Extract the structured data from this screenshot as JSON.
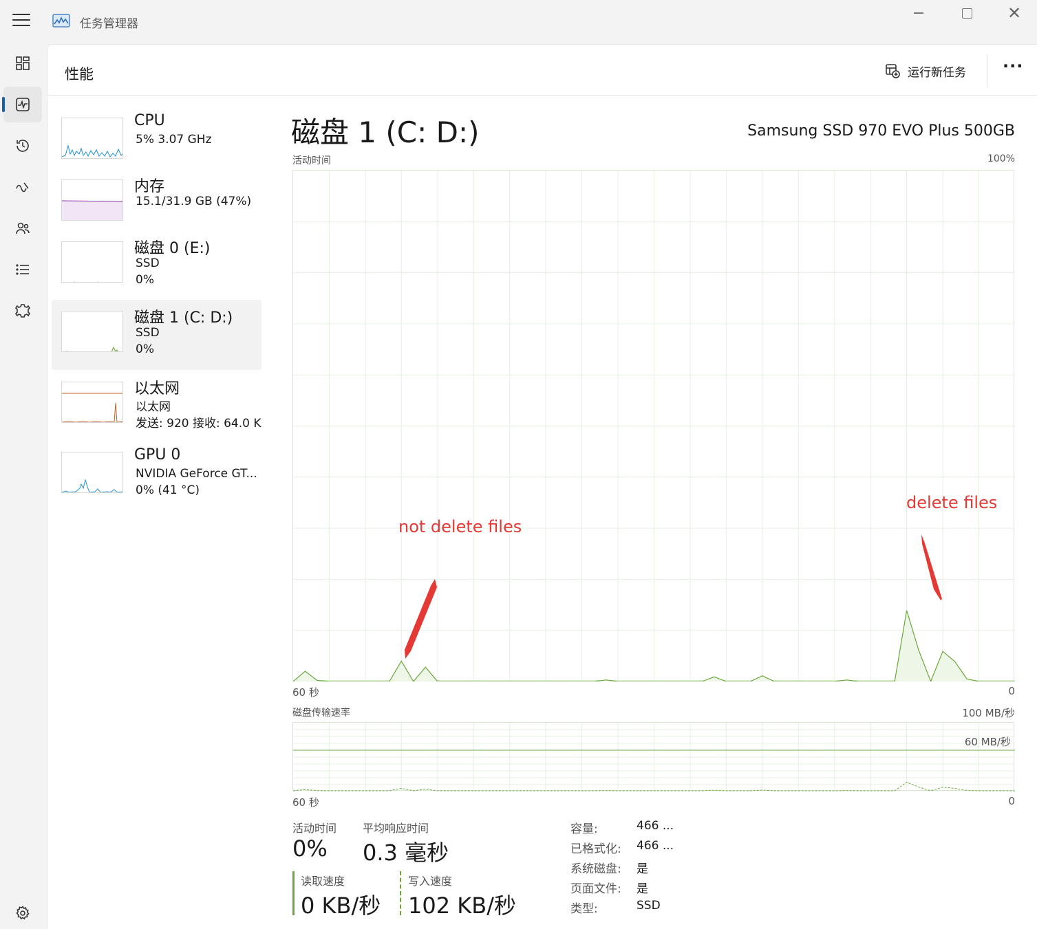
{
  "window": {
    "title": "任务管理器",
    "close_glyph": "✕"
  },
  "header": {
    "page_title": "性能",
    "run_new_task": "运行新任务",
    "more": "···"
  },
  "devices": [
    {
      "name": "CPU",
      "lines": [
        "5%  3.07 GHz"
      ]
    },
    {
      "name": "内存",
      "lines": [
        "15.1/31.9 GB (47%)"
      ]
    },
    {
      "name": "磁盘 0 (E:)",
      "lines": [
        "SSD",
        "0%"
      ]
    },
    {
      "name": "磁盘 1 (C: D:)",
      "lines": [
        "SSD",
        "0%"
      ]
    },
    {
      "name": "以太网",
      "lines": [
        "以太网",
        "发送: 920  接收: 64.0 K"
      ]
    },
    {
      "name": "GPU 0",
      "lines": [
        "NVIDIA GeForce GT...",
        "0%  (41 °C)"
      ]
    }
  ],
  "detail": {
    "title": "磁盘 1 (C: D:)",
    "model": "Samsung SSD 970 EVO Plus 500GB",
    "activity_label": "活动时间",
    "activity_max": "100%",
    "activity_time_left": "60 秒",
    "activity_time_right": "0",
    "transfer_label": "磁盘传输速率",
    "transfer_max": "100 MB/秒",
    "transfer_mid": "60 MB/秒",
    "transfer_time_left": "60 秒",
    "transfer_time_right": "0"
  },
  "annotations": {
    "left": "not delete  files",
    "right": "delete files"
  },
  "stats": {
    "active_time_label": "活动时间",
    "active_time_value": "0%",
    "avg_response_label": "平均响应时间",
    "avg_response_value": "0.3 毫秒",
    "read_label": "读取速度",
    "read_value": "0 KB/秒",
    "write_label": "写入速度",
    "write_value": "102 KB/秒"
  },
  "properties": [
    {
      "key": "容量:",
      "value": "466 ..."
    },
    {
      "key": "已格式化:",
      "value": "466 ..."
    },
    {
      "key": "系统磁盘:",
      "value": "是"
    },
    {
      "key": "页面文件:",
      "value": "是"
    },
    {
      "key": "类型:",
      "value": "SSD"
    }
  ],
  "colors": {
    "disk_line": "#6aa73c",
    "disk_fill": "#eef6e8",
    "grid": "#e6f0e2",
    "annotation": "#e53935",
    "cpu_line": "#1f8fd6",
    "memory_line": "#8e3ea8",
    "ethernet_line": "#c0622b",
    "nav_accent": "#1a5fa8"
  },
  "chart_data": {
    "type": "area",
    "title": "活动时间",
    "x_range_seconds": [
      60,
      0
    ],
    "ylim": [
      0,
      100
    ],
    "y_unit": "%",
    "x": [
      60,
      59,
      58,
      57,
      56,
      55,
      54,
      53,
      52,
      51,
      50,
      49,
      48,
      47,
      46,
      45,
      44,
      43,
      42,
      41,
      40,
      39,
      38,
      37,
      36,
      35,
      34,
      33,
      32,
      31,
      31,
      30,
      29,
      28,
      27,
      26,
      25,
      24,
      23,
      22,
      21,
      20,
      19,
      18,
      17,
      16,
      15,
      14,
      13,
      12,
      11,
      10,
      9,
      8,
      7,
      6,
      5,
      4,
      3,
      2,
      1,
      0
    ],
    "values": [
      0,
      2,
      0.2,
      0,
      0,
      0,
      0,
      0,
      0,
      4,
      0,
      2.8,
      0,
      0,
      0,
      0,
      0,
      0,
      0,
      0,
      0,
      0,
      0,
      0,
      0,
      0,
      0.3,
      0,
      0,
      0,
      0,
      0,
      0,
      0,
      0,
      0,
      0.9,
      0,
      0,
      0,
      1.1,
      0,
      0,
      0,
      0,
      0,
      0,
      0.3,
      0,
      0,
      0,
      0,
      13.9,
      6.1,
      0,
      5.9,
      3.9,
      0.5,
      0,
      0,
      0,
      0
    ]
  }
}
